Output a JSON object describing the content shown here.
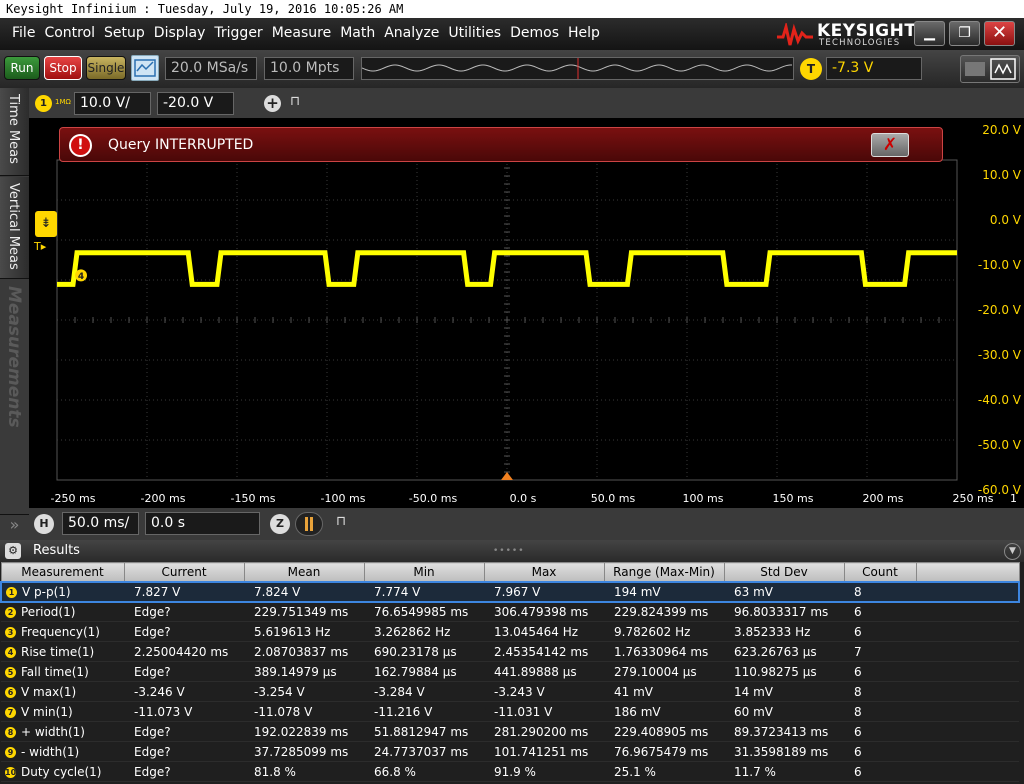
{
  "window": {
    "title": "Keysight Infiniium : Tuesday, July 19, 2016 10:05:26 AM"
  },
  "menu": [
    "File",
    "Control",
    "Setup",
    "Display",
    "Trigger",
    "Measure",
    "Math",
    "Analyze",
    "Utilities",
    "Demos",
    "Help"
  ],
  "logo": {
    "brand": "KEYSIGHT",
    "sub": "TECHNOLOGIES"
  },
  "toolbar": {
    "run": "Run",
    "stop": "Stop",
    "single": "Single",
    "sample_rate": "20.0 MSa/s",
    "memory_depth": "10.0 Mpts",
    "trigger_badge": "T",
    "trigger_level": "-7.3 V"
  },
  "sidetabs": [
    "Time Meas",
    "Vertical Meas",
    "Measurements"
  ],
  "channel": {
    "badge": "1",
    "impedance": "1MΩ",
    "scale": "10.0 V/",
    "offset": "-20.0 V"
  },
  "dialog": {
    "message": "Query INTERRUPTED"
  },
  "display": {
    "channel_marker": "4",
    "trigger_marker": "T",
    "y_labels": [
      "20.0 V",
      "10.0 V",
      "0.0 V",
      "-10.0 V",
      "-20.0 V",
      "-30.0 V",
      "-40.0 V",
      "-50.0 V",
      "-60.0 V"
    ],
    "x_labels": [
      "-250 ms",
      "-200 ms",
      "-150 ms",
      "-100 ms",
      "-50.0 ms",
      "0.0 s",
      "50.0 ms",
      "100 ms",
      "150 ms",
      "200 ms",
      "250 ms"
    ],
    "x_end_label": "1",
    "waveform_color": "#ffff00",
    "grid_color": "#3a3a3a"
  },
  "waveform": {
    "x_range_ms": [
      -250,
      250
    ],
    "y_range_v": [
      -60,
      20
    ],
    "high_v": -3.2,
    "low_v": -11.1,
    "transitions_ms": [
      -240,
      -176,
      -160,
      -100,
      -84,
      -23,
      -8,
      45,
      68,
      121,
      145,
      198,
      222
    ]
  },
  "horizontal": {
    "badge": "H",
    "scale": "50.0 ms/",
    "position": "0.0 s",
    "zoom_badge": "Z"
  },
  "results": {
    "title": "Results",
    "columns": [
      "Measurement",
      "Current",
      "Mean",
      "Min",
      "Max",
      "Range (Max-Min)",
      "Std Dev",
      "Count"
    ],
    "rows": [
      {
        "badge": "1",
        "name": "V p-p(1)",
        "cells": [
          "7.827 V",
          "7.824 V",
          "7.774 V",
          "7.967 V",
          "194 mV",
          "63 mV",
          "8"
        ]
      },
      {
        "badge": "2",
        "name": "Period(1)",
        "cells": [
          "Edge?",
          "229.751349 ms",
          "76.6549985 ms",
          "306.479398 ms",
          "229.824399 ms",
          "96.8033317 ms",
          "6"
        ]
      },
      {
        "badge": "3",
        "name": "Frequency(1)",
        "cells": [
          "Edge?",
          "5.619613 Hz",
          "3.262862 Hz",
          "13.045464 Hz",
          "9.782602 Hz",
          "3.852333 Hz",
          "6"
        ]
      },
      {
        "badge": "4",
        "name": "Rise time(1)",
        "cells": [
          "2.25004420 ms",
          "2.08703837 ms",
          "690.23178 µs",
          "2.45354142 ms",
          "1.76330964 ms",
          "623.26763 µs",
          "7"
        ]
      },
      {
        "badge": "5",
        "name": "Fall time(1)",
        "cells": [
          "Edge?",
          "389.14979 µs",
          "162.79884 µs",
          "441.89888 µs",
          "279.10004 µs",
          "110.98275 µs",
          "6"
        ]
      },
      {
        "badge": "6",
        "name": "V max(1)",
        "cells": [
          "-3.246 V",
          "-3.254 V",
          "-3.284 V",
          "-3.243 V",
          "41 mV",
          "14 mV",
          "8"
        ]
      },
      {
        "badge": "7",
        "name": "V min(1)",
        "cells": [
          "-11.073 V",
          "-11.078 V",
          "-11.216 V",
          "-11.031 V",
          "186 mV",
          "60 mV",
          "8"
        ]
      },
      {
        "badge": "8",
        "name": "+ width(1)",
        "cells": [
          "Edge?",
          "192.022839 ms",
          "51.8812947 ms",
          "281.290200 ms",
          "229.408905 ms",
          "89.3723413 ms",
          "6"
        ]
      },
      {
        "badge": "9",
        "name": "- width(1)",
        "cells": [
          "Edge?",
          "37.7285099 ms",
          "24.7737037 ms",
          "101.741251 ms",
          "76.9675479 ms",
          "31.3598189 ms",
          "6"
        ]
      },
      {
        "badge": "10",
        "name": "Duty cycle(1)",
        "cells": [
          "Edge?",
          "81.8 %",
          "66.8 %",
          "91.9 %",
          "25.1 %",
          "11.7 %",
          "6"
        ]
      }
    ]
  }
}
